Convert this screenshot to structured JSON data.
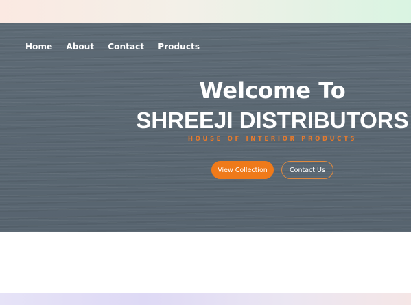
{
  "nav": {
    "items": [
      {
        "label": "Home"
      },
      {
        "label": "About"
      },
      {
        "label": "Contact"
      },
      {
        "label": "Products"
      }
    ]
  },
  "hero": {
    "welcome": "Welcome To",
    "company": "SHREEJI DISTRIBUTORS",
    "tagline": "HOUSE OF INTERIOR PRODUCTS",
    "primary_button": "View Collection",
    "secondary_button": "Contact Us"
  },
  "colors": {
    "accent": "#ef7a1a",
    "hero_background": "#5b6873",
    "text_light": "#ffffff"
  }
}
